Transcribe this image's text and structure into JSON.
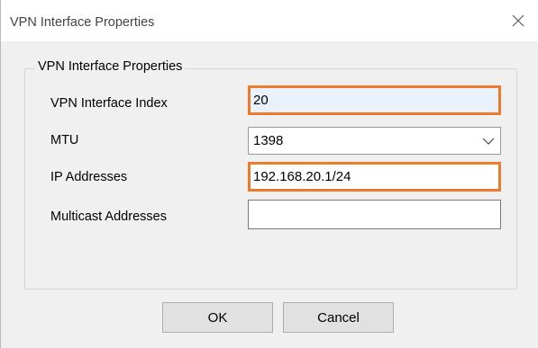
{
  "window": {
    "title": "VPN Interface Properties",
    "close_icon": "close-icon"
  },
  "group": {
    "label": "VPN Interface Properties"
  },
  "fields": {
    "vpn_index": {
      "label": "VPN Interface Index",
      "value": "20"
    },
    "mtu": {
      "label": "MTU",
      "value": "1398",
      "icon": "chevron-down-icon"
    },
    "ip_addresses": {
      "label": "IP Addresses",
      "value": "192.168.20.1/24"
    },
    "multicast_addresses": {
      "label": "Multicast Addresses",
      "value": ""
    }
  },
  "buttons": {
    "ok_label": "OK",
    "cancel_label": "Cancel"
  },
  "colors": {
    "highlight": "#ee7b2c",
    "readonly_fill": "#e9f1fb"
  }
}
